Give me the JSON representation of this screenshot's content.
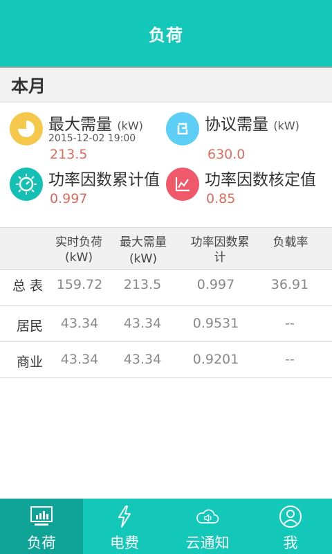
{
  "header": {
    "title": "负荷"
  },
  "section": {
    "title": "本月"
  },
  "stats": {
    "max_demand": {
      "label": "最大需量",
      "unit": "(kW)",
      "time": "2015-12-02 19:00",
      "value": "213.5",
      "color": "#f5c84c"
    },
    "agreed_demand": {
      "label": "协议需量",
      "unit": "(kW)",
      "value": "630.0",
      "color": "#5dcef5"
    },
    "pf_cumulative": {
      "label": "功率因数累计值",
      "value": "0.997",
      "color": "#13c0b3"
    },
    "pf_rated": {
      "label": "功率因数核定值",
      "value": "0.85",
      "color": "#f0596a"
    }
  },
  "table": {
    "headers": [
      {
        "l1": "实时负荷",
        "l2": "(kW)"
      },
      {
        "l1": "最大需量",
        "l2": "(kW)"
      },
      {
        "l1": "功率因数累",
        "l2": "计"
      },
      {
        "l1": "负载率",
        "l2": ""
      }
    ],
    "rows": [
      {
        "name": "总  表",
        "c": [
          "159.72",
          "213.5",
          "0.997",
          "36.91"
        ]
      },
      {
        "name": "居民",
        "c": [
          "43.34",
          "43.34",
          "0.9531",
          "--"
        ]
      },
      {
        "name": "商业",
        "c": [
          "43.34",
          "43.34",
          "0.9201",
          "--"
        ]
      }
    ]
  },
  "tabs": [
    {
      "label": "负荷",
      "icon": "monitor-chart-icon",
      "active": true
    },
    {
      "label": "电费",
      "icon": "lightning-icon",
      "active": false
    },
    {
      "label": "云通知",
      "icon": "cloud-speaker-icon",
      "active": false
    },
    {
      "label": "我",
      "icon": "user-icon",
      "active": false
    }
  ],
  "colors": {
    "brand": "#13c8b8",
    "brand_dark": "#0fa497",
    "value_red": "#e06a5e"
  }
}
